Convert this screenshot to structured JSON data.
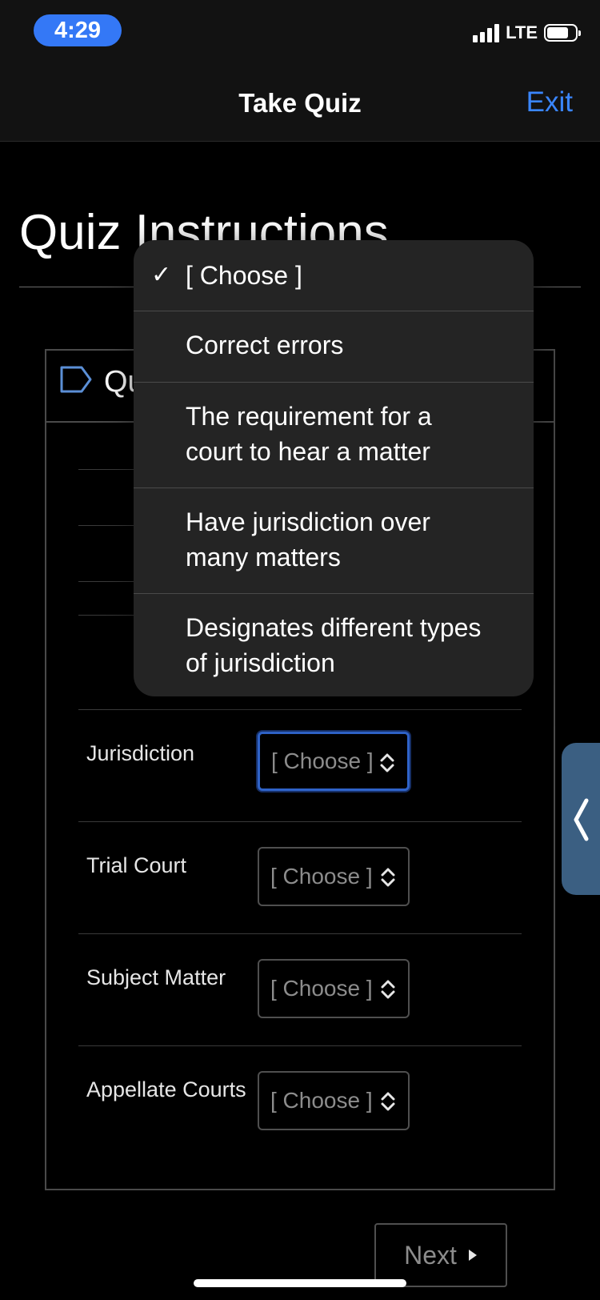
{
  "status_bar": {
    "time": "4:29",
    "network": "LTE"
  },
  "nav": {
    "title": "Take Quiz",
    "exit_label": "Exit"
  },
  "page": {
    "title": "Quiz Instructions"
  },
  "card": {
    "header_text": "Qu"
  },
  "questions": [
    {
      "label": "Jurisdiction",
      "selected": "[ Choose ]"
    },
    {
      "label": "Trial Court",
      "selected": "[ Choose ]"
    },
    {
      "label": "Subject Matter",
      "selected": "[ Choose ]"
    },
    {
      "label": "Appellate Courts",
      "selected": "[ Choose ]"
    }
  ],
  "dropdown": {
    "options": [
      {
        "line1": "[ Choose ]",
        "line2": "",
        "checked": true
      },
      {
        "line1": "Correct errors",
        "line2": "",
        "checked": false
      },
      {
        "line1": "The requirement for a",
        "line2": "court to hear a matter",
        "checked": false
      },
      {
        "line1": "Have jurisdiction over",
        "line2": "many matters",
        "checked": false
      },
      {
        "line1": "Designates different types",
        "line2": "of jurisdiction",
        "checked": false
      }
    ],
    "check_glyph": "✓"
  },
  "footer": {
    "next_label": "Next"
  },
  "colors": {
    "accent": "#3a86ff",
    "time_pill": "#3478f6",
    "side_tab": "#3b5f82",
    "focus_ring": "#2f63c9"
  }
}
